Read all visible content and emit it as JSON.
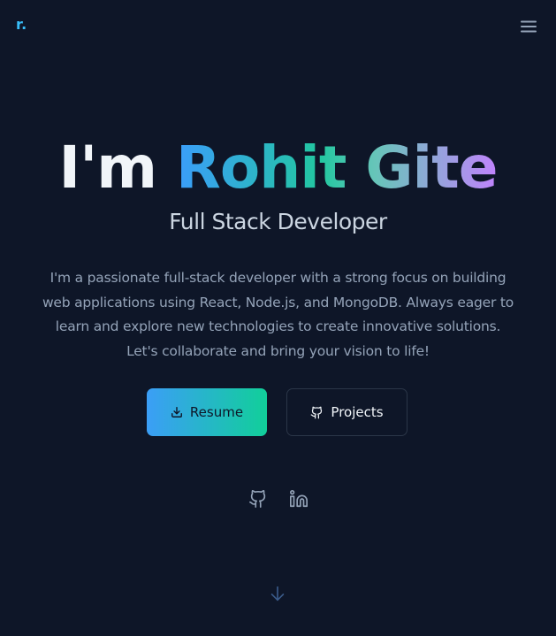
{
  "nav": {
    "logo": "r.",
    "menu_icon": "hamburger-menu-icon"
  },
  "hero": {
    "greeting": "I'm",
    "name": "Rohit Gite",
    "subtitle": "Full Stack Developer",
    "bio": "I'm a passionate full-stack developer with a strong focus on building web applications using React, Node.js, and MongoDB. Always eager to learn and explore new technologies to create innovative solutions. Let's collaborate and bring your vision to life!"
  },
  "actions": {
    "resume_label": "Resume",
    "resume_icon": "download-icon",
    "projects_label": "Projects",
    "projects_icon": "github-icon"
  },
  "socials": [
    {
      "icon": "github-icon"
    },
    {
      "icon": "linkedin-icon"
    }
  ],
  "scroll": {
    "icon": "arrow-down-icon"
  },
  "colors": {
    "background": "#0e1628",
    "accent_blue": "#3b9dfb",
    "accent_green": "#11cf9a",
    "accent_purple": "#c084fc",
    "logo": "#38bdf8"
  }
}
